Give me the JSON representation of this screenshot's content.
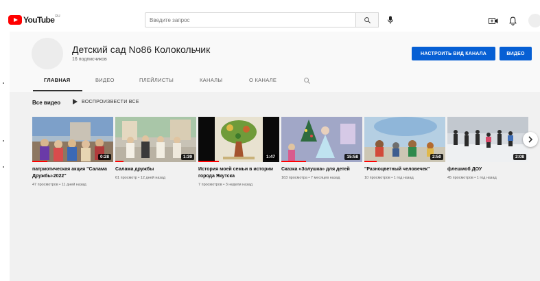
{
  "header": {
    "logo_text": "YouTube",
    "logo_region": "RU",
    "search_placeholder": "Введите запрос"
  },
  "channel": {
    "name": "Детский сад No86 Колокольчик",
    "subscribers": "16 подписчиков",
    "customize_button": "НАСТРОИТЬ ВИД КАНАЛА",
    "videos_button": "ВИДЕО"
  },
  "tabs": [
    {
      "label": "ГЛАВНАЯ",
      "active": true
    },
    {
      "label": "ВИДЕО",
      "active": false
    },
    {
      "label": "ПЛЕЙЛИСТЫ",
      "active": false
    },
    {
      "label": "КАНАЛЫ",
      "active": false
    },
    {
      "label": "О КАНАЛЕ",
      "active": false
    }
  ],
  "section": {
    "title": "Все видео",
    "play_all": "ВОСПРОИЗВЕСТИ ВСЕ"
  },
  "videos": [
    {
      "title": "патриотическая акция \"Салама Дружбы-2022\"",
      "duration": "0:28",
      "meta": "47 просмотров • 11 дней назад"
    },
    {
      "title": "Салама дружбы",
      "duration": "1:39",
      "meta": "61 просмотр • 12 дней назад"
    },
    {
      "title": "История моей семьи в истории города Якутска",
      "duration": "1:47",
      "meta": "7 просмотров • 3 недели назад"
    },
    {
      "title": "Сказка «Золушка» для детей",
      "duration": "15:58",
      "meta": "163 просмотра • 7 месяцев назад"
    },
    {
      "title": "\"Разноцветный человечек\"",
      "duration": "2:50",
      "meta": "10 просмотров • 1 год назад"
    },
    {
      "title": "флешмоб ДОУ",
      "duration": "2:08",
      "meta": "45 просмотров • 1 год назад"
    }
  ],
  "icons": {
    "search": "search-icon",
    "mic": "mic-icon",
    "create": "create-video-icon",
    "notifications": "bell-icon",
    "play": "play-icon",
    "next": "chevron-right-icon",
    "tab_search": "search-icon"
  },
  "colors": {
    "brand_red": "#ff0000",
    "accent_blue": "#065fd4"
  }
}
